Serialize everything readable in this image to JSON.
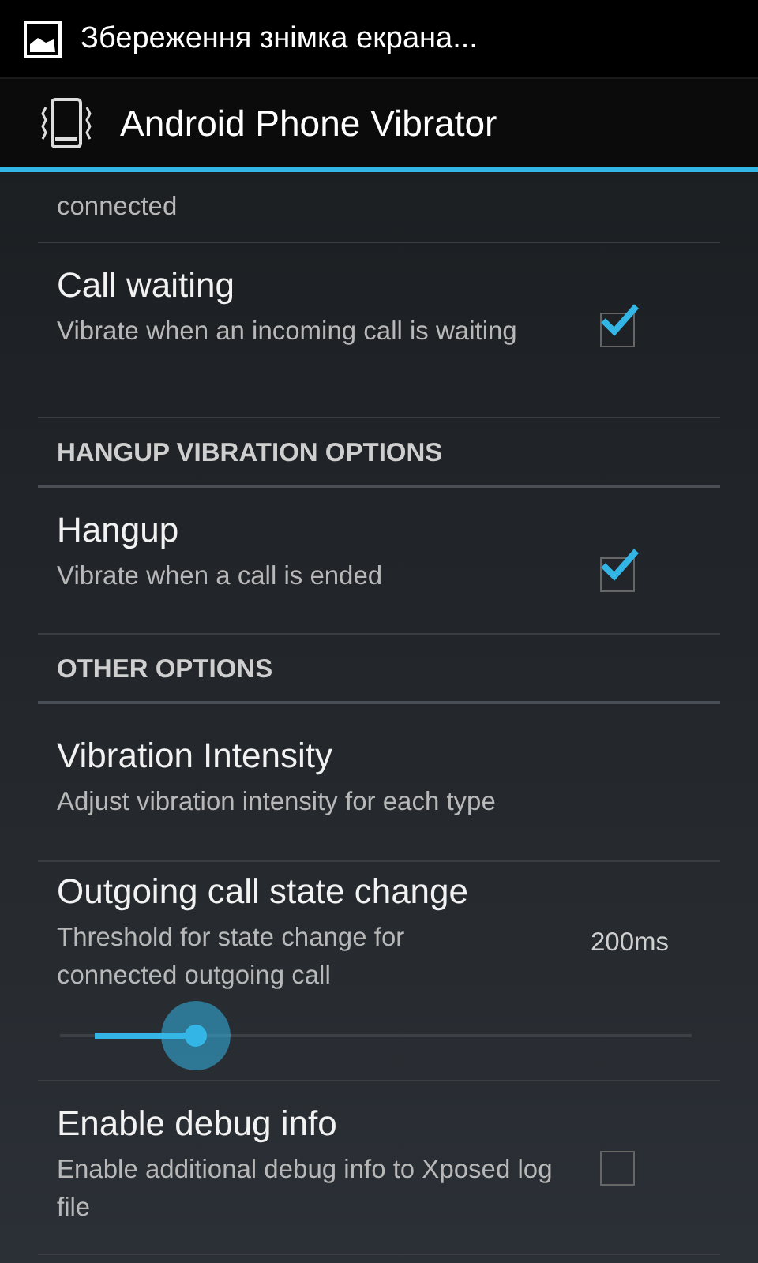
{
  "status_bar": {
    "notification": "Збереження знімка екрана..."
  },
  "action_bar": {
    "title": "Android Phone Vibrator"
  },
  "items": [
    {
      "kind": "partial",
      "summary": "connected"
    },
    {
      "kind": "checkbox",
      "title": "Call waiting",
      "summary": "Vibrate when an incoming call is waiting",
      "checked": true
    },
    {
      "kind": "category",
      "title": "HANGUP VIBRATION OPTIONS"
    },
    {
      "kind": "checkbox",
      "title": "Hangup",
      "summary": "Vibrate when a call is ended",
      "checked": true
    },
    {
      "kind": "category",
      "title": "OTHER OPTIONS"
    },
    {
      "kind": "plain",
      "title": "Vibration Intensity",
      "summary": "Adjust vibration intensity for each type"
    },
    {
      "kind": "slider",
      "title": "Outgoing call state change",
      "summary": "Threshold for state change for connected outgoing call",
      "reading": "200ms",
      "level": 0.18
    },
    {
      "kind": "checkbox",
      "title": "Enable debug info",
      "summary": "Enable additional debug info to Xposed log file",
      "checked": false
    }
  ]
}
